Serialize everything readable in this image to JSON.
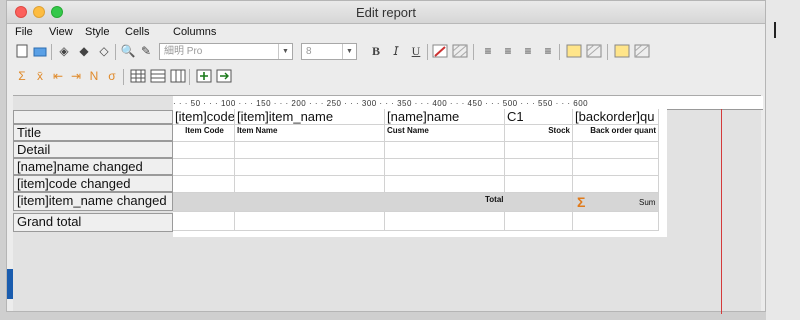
{
  "window": {
    "title": "Edit report"
  },
  "menu": [
    "File",
    "View",
    "Style",
    "Cells",
    "Columns"
  ],
  "toolbar": {
    "font_name": "細明 Pro",
    "font_size": "8",
    "bold": "B",
    "italic": "𝘐",
    "underline": "U"
  },
  "ruler": {
    "text": "· · · 50 · · · 100 · · · 150 · · · 200 · · · 250 · · · 300 · · · 350 · · · 400 · · · 450 · · · 500 · · · 550 · · · 600"
  },
  "rows": [
    "Title",
    "Detail",
    "[name]name changed",
    "[item]code changed",
    "[item]item_name changed",
    "Grand total"
  ],
  "columns": {
    "headers": [
      "[item]code",
      "[item]item_name",
      "[name]name",
      "C1",
      "[backorder]qu"
    ],
    "subheaders": [
      "Item Code",
      "Item Name",
      "Cust Name",
      "Stock",
      "Back order quant"
    ]
  },
  "subtotal": {
    "total_label": "Total",
    "sum_icon": "Σ",
    "sum_label": "Sum"
  }
}
